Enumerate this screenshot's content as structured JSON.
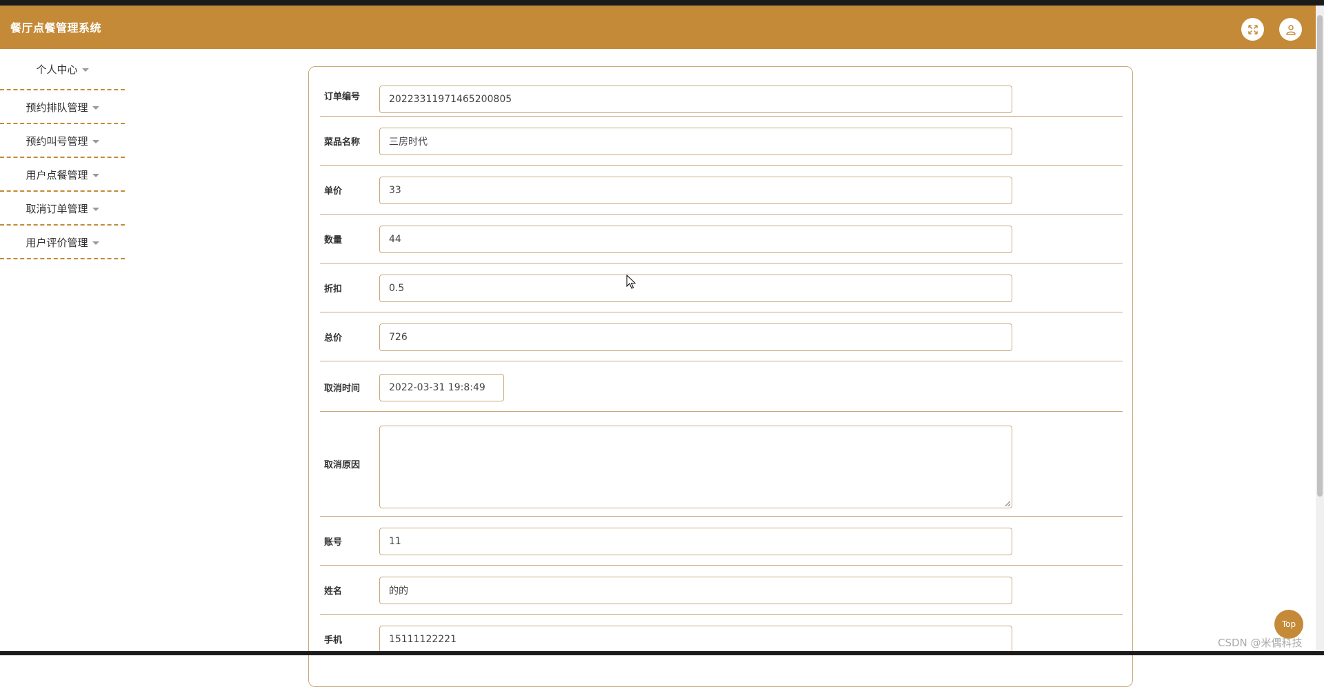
{
  "app": {
    "title": "餐厅点餐管理系统"
  },
  "header": {
    "fullscreen_icon": "fullscreen-icon",
    "user_icon": "user-icon"
  },
  "sidebar": {
    "items": [
      {
        "label": "个人中心"
      },
      {
        "label": "预约排队管理"
      },
      {
        "label": "预约叫号管理"
      },
      {
        "label": "用户点餐管理"
      },
      {
        "label": "取消订单管理"
      },
      {
        "label": "用户评价管理"
      }
    ]
  },
  "form": {
    "order_no": {
      "label": "订单编号",
      "value": "20223311971465200805"
    },
    "dish_name": {
      "label": "菜品名称",
      "value": "三房时代"
    },
    "unit_price": {
      "label": "单价",
      "value": "33"
    },
    "quantity": {
      "label": "数量",
      "value": "44"
    },
    "discount": {
      "label": "折扣",
      "value": "0.5"
    },
    "total": {
      "label": "总价",
      "value": "726"
    },
    "cancel_time": {
      "label": "取消时间",
      "value": "2022-03-31 19:8:49"
    },
    "cancel_reason": {
      "label": "取消原因",
      "value": ""
    },
    "account": {
      "label": "账号",
      "value": "11"
    },
    "name": {
      "label": "姓名",
      "value": "的的"
    },
    "phone": {
      "label": "手机",
      "value": "15111122221"
    }
  },
  "top_button": {
    "label": "Top"
  },
  "watermark": {
    "text": "CSDN @米偶科技"
  },
  "colors": {
    "accent": "#c48a38",
    "border": "#c9a87c"
  }
}
